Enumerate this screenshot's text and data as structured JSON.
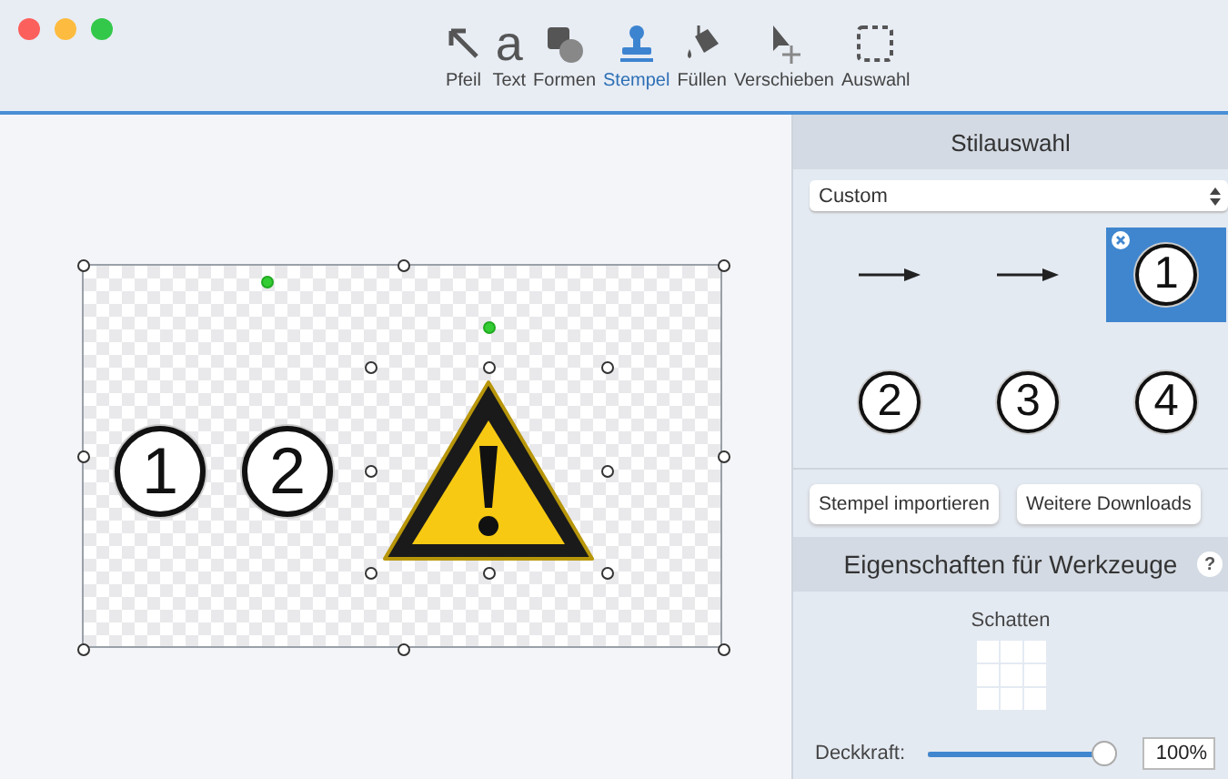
{
  "toolbar": {
    "tools": [
      {
        "kind": "arrow",
        "label": "Pfeil",
        "selected": false
      },
      {
        "kind": "text",
        "glyph": "a",
        "label": "Text",
        "selected": false
      },
      {
        "kind": "shapes",
        "label": "Formen",
        "selected": false
      },
      {
        "kind": "stamp",
        "label": "Stempel",
        "selected": true
      },
      {
        "kind": "fill",
        "label": "Füllen",
        "selected": false
      },
      {
        "kind": "move",
        "label": "Verschieben",
        "selected": false
      },
      {
        "kind": "select",
        "label": "Auswahl",
        "selected": false
      }
    ]
  },
  "canvas": {
    "items": [
      {
        "kind": "number",
        "label": "1"
      },
      {
        "kind": "number",
        "label": "2"
      },
      {
        "kind": "warning"
      }
    ]
  },
  "style_panel": {
    "title": "Stilauswahl",
    "dropdown": "Custom",
    "stamps": [
      {
        "kind": "arrow",
        "selected": false
      },
      {
        "kind": "arrow",
        "selected": false
      },
      {
        "kind": "number",
        "label": "1",
        "selected": true
      },
      {
        "kind": "number",
        "label": "2",
        "selected": false
      },
      {
        "kind": "number",
        "label": "3",
        "selected": false
      },
      {
        "kind": "number",
        "label": "4",
        "selected": false
      }
    ],
    "buttons": [
      "Stempel importieren",
      "Weitere Downloads"
    ]
  },
  "properties": {
    "title": "Eigenschaften für Werkzeuge",
    "help": "?",
    "shadow_label": "Schatten",
    "opacity_label": "Deckkraft:",
    "opacity": {
      "level": 0.97
    },
    "opacity_value": "100%"
  }
}
